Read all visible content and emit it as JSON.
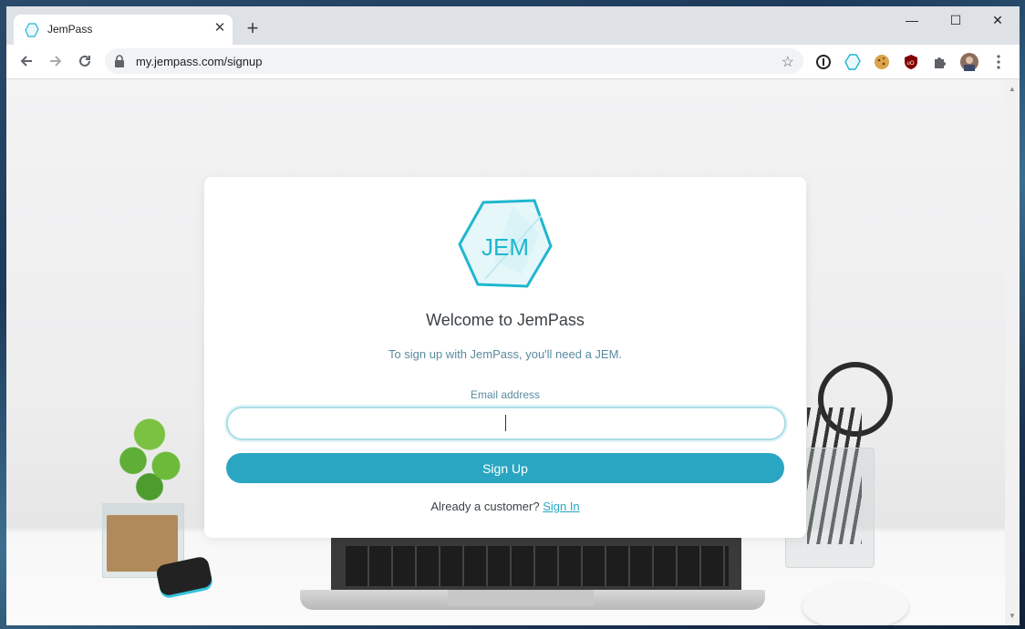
{
  "browser": {
    "tab_title": "JemPass",
    "tab_close": "✕",
    "new_tab": "+",
    "url": "my.jempass.com/signup",
    "window_controls": {
      "minimize": "—",
      "maximize": "☐",
      "close": "✕"
    }
  },
  "page": {
    "logo_text": "JEM",
    "welcome": "Welcome to JemPass",
    "subtitle": "To sign up with JemPass, you'll need a JEM.",
    "email_label": "Email address",
    "email_value": "",
    "signup_label": "Sign Up",
    "already_text": "Already a customer?",
    "signin_link": "Sign In"
  },
  "colors": {
    "accent": "#2aa6c2",
    "logo": "#1fb7cf"
  },
  "icons": [
    "back-icon",
    "forward-icon",
    "reload-icon",
    "lock-icon",
    "star-icon",
    "password-ext-icon",
    "jempass-ext-icon",
    "cookie-ext-icon",
    "ublock-ext-icon",
    "puzzle-icon",
    "avatar",
    "menu-icon"
  ]
}
